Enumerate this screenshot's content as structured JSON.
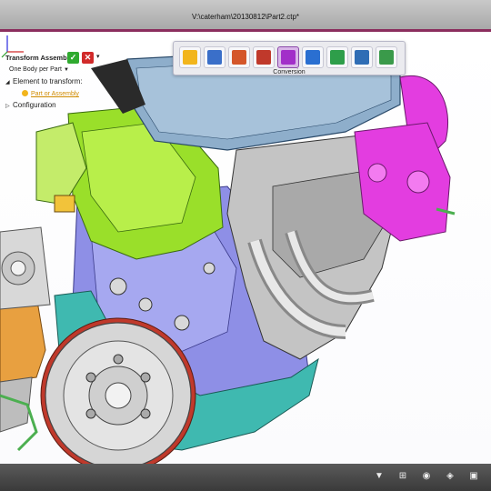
{
  "window": {
    "title": "V:\\caterham\\20130812\\Part2.ctp*"
  },
  "panel": {
    "title": "Transform Assembly",
    "mode_value": "One Body per Part",
    "element_label": "Element to transform:",
    "element_link": "Part or Assembly",
    "configuration_label": "Configuration",
    "ok_icon": "check-icon",
    "cancel_icon": "close-icon",
    "ok_glyph": "✓",
    "cancel_glyph": "✕"
  },
  "toolbar": {
    "buttons": [
      {
        "icon": "magnify-icon",
        "color": "#f2b51c"
      },
      {
        "icon": "edit-icon",
        "color": "#3a6fc9"
      },
      {
        "icon": "tools-icon",
        "color": "#d4562a"
      },
      {
        "icon": "steps-icon",
        "color": "#c0392b"
      },
      {
        "icon": "conversion-icon",
        "color": "#a22ec9"
      },
      {
        "icon": "export-icon",
        "color": "#2a6fd1"
      },
      {
        "icon": "frame-icon",
        "color": "#2e9e4a"
      },
      {
        "icon": "nodes-icon",
        "color": "#2f6db5"
      },
      {
        "icon": "toolbox-icon",
        "color": "#3a9a4a"
      }
    ],
    "active_label": "Conversion"
  },
  "bottombar": {
    "icons": [
      "filter-icon",
      "grid-icon",
      "eye-icon",
      "cube-icon",
      "box-icon"
    ]
  },
  "colors": {
    "accent": "#8b2e5e",
    "engine_blue": "#8e8fe6",
    "bracket_green": "#9adf2a",
    "pump_magenta": "#e33de0",
    "block_teal": "#3fb9b0",
    "manifold_grey": "#c4c4c4",
    "flywheel_grey": "#d6d6d6",
    "flywheel_teeth": "#c0392b",
    "cat_orange": "#e8a040",
    "cover_blue": "#8eaecb"
  }
}
